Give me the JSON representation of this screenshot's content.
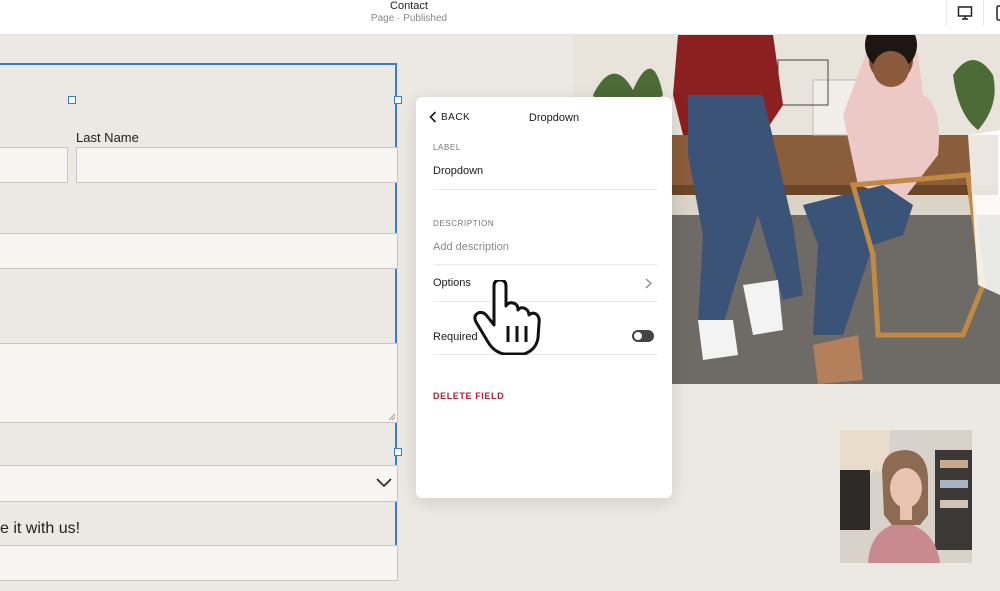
{
  "header": {
    "page_title": "Contact",
    "page_status": "Page · Published",
    "desktop_view_icon": "desktop-icon",
    "mobile_view_icon": "mobile-icon"
  },
  "form": {
    "last_name_label": "Last Name",
    "partial_label": "e it with us!",
    "dropdown_icon": "chevron-down-icon"
  },
  "panel": {
    "back_label": "BACK",
    "title": "Dropdown",
    "label_caption": "LABEL",
    "label_value": "Dropdown",
    "description_caption": "DESCRIPTION",
    "description_placeholder": "Add description",
    "options_label": "Options",
    "required_label": "Required",
    "required_on": false,
    "delete_label": "DELETE FIELD"
  },
  "colors": {
    "accent": "#3b7bd6",
    "delete": "#b0213a",
    "canvas": "#ece8e3"
  }
}
